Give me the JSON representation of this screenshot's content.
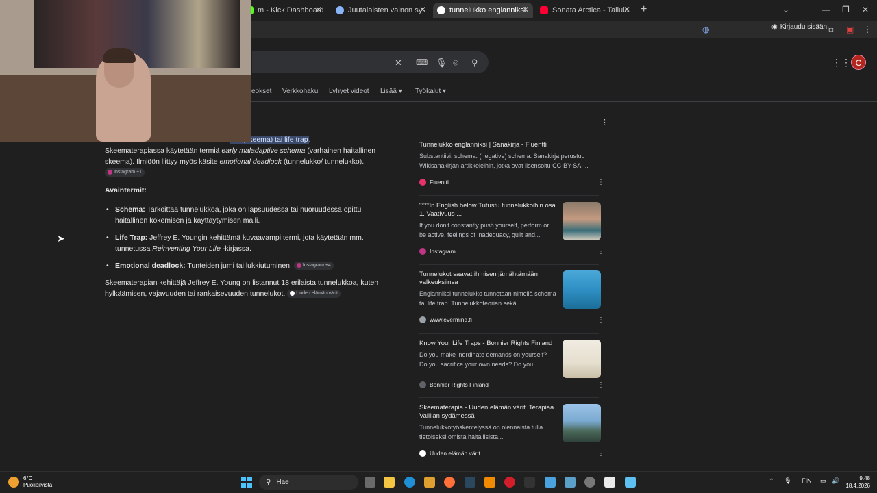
{
  "browser": {
    "tabs": [
      {
        "label": "m - Kick Dashboard",
        "favicon_color": "#53fc18",
        "active": false
      },
      {
        "label": "Juutalaisten vainon syyt ja aikal",
        "favicon_color": "#8ab4f8",
        "active": false
      },
      {
        "label": "tunnelukko englanniksi - Goog",
        "favicon_color": "#4285f4",
        "active": true
      },
      {
        "label": "Sonata Arctica - Tallulah - YouT",
        "favicon_color": "#ff0033",
        "active": false
      }
    ],
    "new_tab_icon": "plus-icon",
    "signin_label": "Kirjaudu sisään"
  },
  "search": {
    "clear_icon": "close-icon",
    "keyboard_icon": "keyboard-icon",
    "mic_icon": "mic-icon",
    "lens_icon": "lens-icon",
    "search_icon": "search-icon",
    "avatar_letter": "C",
    "avatar_color": "#b3261e"
  },
  "nav_tabs": [
    "eokset",
    "Verkkohaku",
    "Lyhyet videot",
    "Lisää",
    "Työkalut"
  ],
  "ai_overview": {
    "first_line_hl": "ma (skeema) tai life trap",
    "first_line_end": ".",
    "p1_a": "Skeematerapiassa käytetään termiä ",
    "p1_em1": "early maladaptive schema",
    "p1_b": " (varhainen haitallinen skeema). Ilmiöön liittyy myös käsite ",
    "p1_em2": "emotional deadlock",
    "p1_c": " (tunnelukko/ tunnelukko).",
    "p1_chip": "Instagram +1",
    "key_terms_heading": "Avaintermit:",
    "bullets": [
      {
        "term": "Schema:",
        "text": " Tarkoittaa tunnelukkoa, joka on lapsuudessa tai nuoruudessa opittu haitallinen kokemisen ja käyttäytymisen malli."
      },
      {
        "term": "Life Trap:",
        "text": " Jeffrey E. Youngin kehittämä kuvaavampi termi, jota käytetään mm. tunnetussa ",
        "em": "Reinventing Your Life",
        "text2": " -kirjassa."
      },
      {
        "term": "Emotional deadlock:",
        "text": " Tunteiden jumi tai lukkiutuminen.",
        "chip": "Instagram +4"
      }
    ],
    "p2": "Skeematerapian kehittäjä Jeffrey E. Young on listannut 18 erilaista tunnelukkoa, kuten hylkäämisen, vajavuuden tai rankaisevuuden tunnelukot.",
    "p2_chip": "Uuden elämän värit"
  },
  "results": [
    {
      "title": "Tunnelukko englanniksi | Sanakirja - Fluentti",
      "snippet": "Substantiivi. schema. (negative) schema. Sanakirja perustuu Wikisanakirjan artikkeleihin, jotka ovat lisensoitu CC-BY-SA-...",
      "source": "Fluentti",
      "source_color": "#e8336a"
    },
    {
      "title": "\"***In English below Tutustu tunnelukkoihin osa 1. Vaativuus ...",
      "snippet": "If you don't constantly push yourself, perform or be active, feelings of inadequacy, guilt and...",
      "source": "Instagram",
      "source_color": "#c13584"
    },
    {
      "title": "Tunnelukot saavat ihmisen jämähtämään valkeuksiinsa",
      "snippet": "Englanniksi tunnelukko tunnetaan nimellä schema tai life trap. Tunnelukkoteorian sekä...",
      "source": "www.evermind.fi",
      "source_color": "#9aa0a6"
    },
    {
      "title": "Know Your Life Traps - Bonnier Rights Finland",
      "snippet": "Do you make inordinate demands on yourself? Do you sacrifice your own needs? Do you...",
      "source": "Bonnier Rights Finland",
      "source_color": "#5f6368"
    },
    {
      "title": "Skeematerapia - Uuden elämän värit. Terapiaa Vallilan sydämessä",
      "snippet": "Tunnelukkotyöskentelyssä on olennaista tulla tietoiseksi omista haitallisista...",
      "source": "Uuden elämän värit",
      "source_color": "#ffffff"
    }
  ],
  "taskbar": {
    "temperature": "6°C",
    "weather": "Puolipilvistä",
    "search_label": "Hae",
    "lang": "FIN",
    "time": "9.48",
    "date": "18.4.2026"
  }
}
